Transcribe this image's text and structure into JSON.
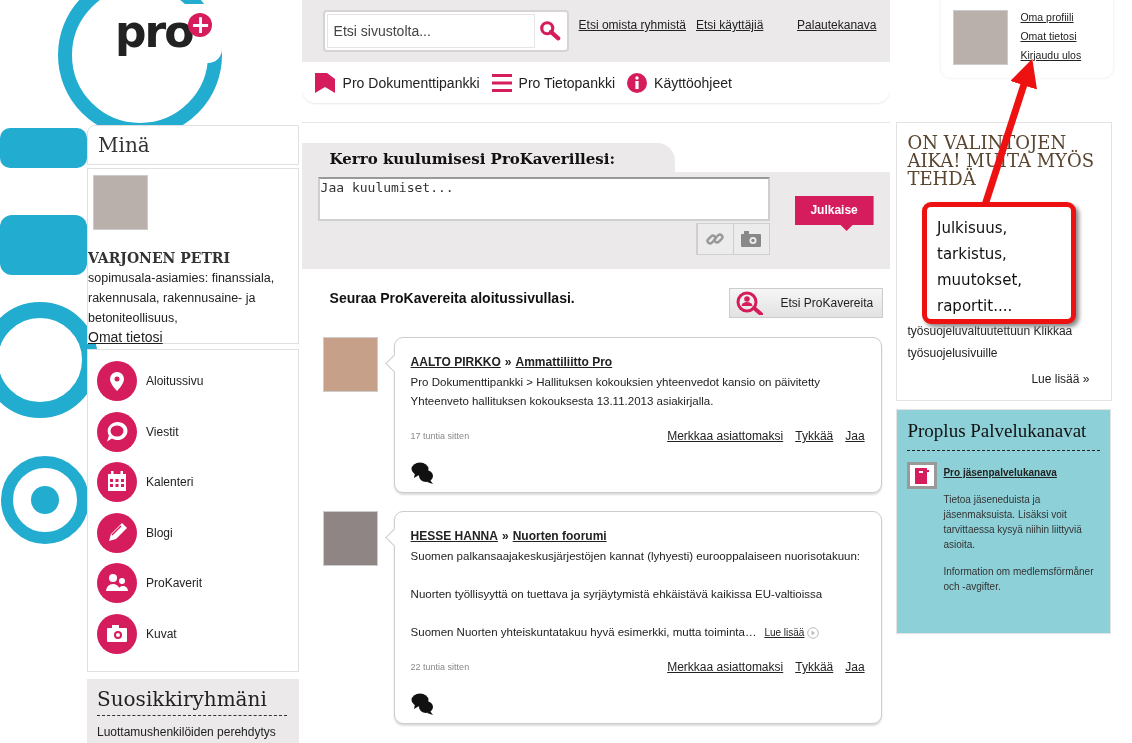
{
  "logo": {
    "text": "pro",
    "mark": "+"
  },
  "header": {
    "search": {
      "placeholder": "Etsi sivustolta..."
    },
    "links": [
      "Etsi omista ryhmistä",
      "Etsi käyttäjiä"
    ],
    "feedback_link": "Palautekanava"
  },
  "nav": [
    {
      "kind": "bookmark",
      "label": "Pro Dokumenttipankki"
    },
    {
      "kind": "list",
      "label": "Pro Tietopankki"
    },
    {
      "kind": "info",
      "label": "Käyttöohjeet"
    }
  ],
  "user_menu": {
    "links": [
      "Oma profiili",
      "Omat tietosi",
      "Kirjaudu ulos"
    ]
  },
  "sidebar": {
    "title": "Minä",
    "profile": {
      "name": "VARJONEN PETRI",
      "description": "sopimusala-asiamies: finanssiala, rakennusala, rakennusaine- ja betoniteollisuus,",
      "link": "Omat tietosi"
    },
    "items": [
      {
        "kind": "pin",
        "label": "Aloitussivu"
      },
      {
        "kind": "speech",
        "label": "Viestit"
      },
      {
        "kind": "calendar",
        "label": "Kalenteri"
      },
      {
        "kind": "pencil",
        "label": "Blogi"
      },
      {
        "kind": "people",
        "label": "ProKaverit"
      },
      {
        "kind": "camera",
        "label": "Kuvat"
      }
    ],
    "favorites": {
      "title": "Suosikkiryhmäni",
      "items": [
        "Luottamushenkilöiden perehdytys"
      ]
    }
  },
  "composer": {
    "title": "Kerro kuulumisesi ProKaverillesi:",
    "placeholder": "Jaa kuulumiset...",
    "publish": "Julkaise"
  },
  "follow": {
    "text": "Seuraa ProKavereita aloitussivullasi.",
    "button": "Etsi ProKavereita"
  },
  "feed": [
    {
      "author": "AALTO PIRKKO",
      "separator": "»",
      "group": "Ammattiliitto Pro",
      "paragraphs": [
        "Pro Dokumenttipankki > Hallituksen kokouksien yhteenvedot kansio on päivitetty Yhteenveto hallituksen kokouksesta 13.11.2013 asiakirjalla."
      ],
      "time": "17 tuntia sitten",
      "actions": [
        "Merkkaa asiattomaksi",
        "Tykkää",
        "Jaa"
      ]
    },
    {
      "author": "HESSE HANNA",
      "separator": "»",
      "group": "Nuorten foorumi",
      "paragraphs": [
        "Suomen palkansaajakeskusjärjestöjen kannat (lyhyesti) eurooppalaiseen nuorisotakuun:",
        "Nuorten työllisyyttä on tuettava ja syrjäytymistä ehkäistävä kaikissa EU-valtioissa",
        "Suomen Nuorten yhteiskuntatakuu hyvä esimerkki, mutta toiminta…"
      ],
      "read_more": "Lue lisää",
      "time": "22 tuntia sitten",
      "actions": [
        "Merkkaa asiattomaksi",
        "Tykkää",
        "Jaa"
      ]
    }
  ],
  "info_box": {
    "heading": "ON VALINTOJEN AIKA! MUITA MYÖS TEHDÄ",
    "body": "työsuojeluvaltuutettuun Klikkaa työsuojelusivuille",
    "more": "Lue lisää »"
  },
  "services": {
    "title": "Proplus Palvelukanavat",
    "link": "Pro jäsenpalvelukanava",
    "paragraphs": [
      "Tietoa jäseneduista ja jäsenmaksuista. Lisäksi voit tarvittaessa kysyä niihin liittyviä asioita.",
      "Information om medlemsförmåner och -avgifter."
    ]
  },
  "callout": {
    "text": "Julkisuus, tarkistus, muutokset, raportit...."
  }
}
